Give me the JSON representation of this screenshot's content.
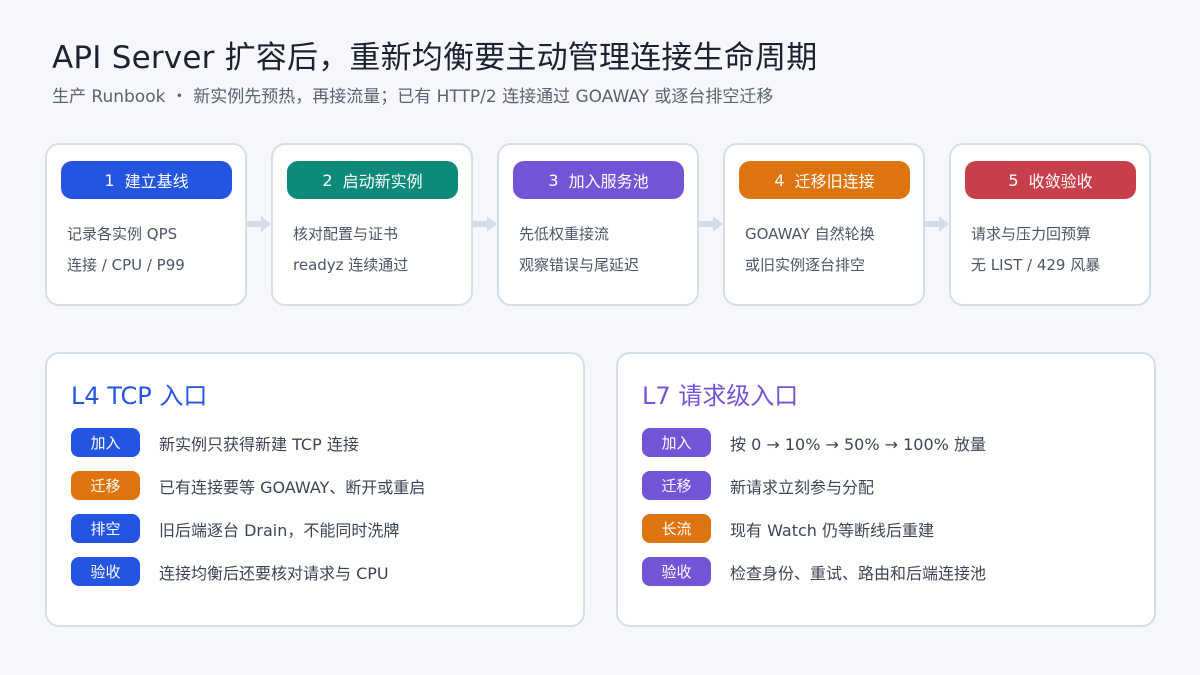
{
  "header": {
    "title": "API Server 扩容后，重新均衡要主动管理连接生命周期",
    "subtitle": "生产 Runbook ・ 新实例先预热，再接流量；已有 HTTP/2 连接通过 GOAWAY 或逐台排空迁移"
  },
  "steps": [
    {
      "num": "1",
      "label": "建立基线",
      "color": "#2355e0",
      "lines": [
        "记录各实例 QPS",
        "连接 / CPU / P99"
      ]
    },
    {
      "num": "2",
      "label": "启动新实例",
      "color": "#0e8a7a",
      "lines": [
        "核对配置与证书",
        "readyz 连续通过"
      ]
    },
    {
      "num": "3",
      "label": "加入服务池",
      "color": "#7454d6",
      "lines": [
        "先低权重接流",
        "观察错误与尾延迟"
      ]
    },
    {
      "num": "4",
      "label": "迁移旧连接",
      "color": "#de7410",
      "lines": [
        "GOAWAY 自然轮换",
        "或旧实例逐台排空"
      ]
    },
    {
      "num": "5",
      "label": "收敛验收",
      "color": "#c83f4c",
      "lines": [
        "请求与压力回预算",
        "无 LIST / 429 风暴"
      ]
    }
  ],
  "colors": {
    "arrow": "#d6dce8",
    "l4_title": "#2355e0",
    "l7_title": "#7454d6"
  },
  "panels": {
    "l4": {
      "title": "L4 TCP 入口",
      "rows": [
        {
          "tag": "加入",
          "color": "#2355e0",
          "text": "新实例只获得新建 TCP 连接"
        },
        {
          "tag": "迁移",
          "color": "#de7410",
          "text": "已有连接要等 GOAWAY、断开或重启"
        },
        {
          "tag": "排空",
          "color": "#2355e0",
          "text": "旧后端逐台 Drain，不能同时洗牌"
        },
        {
          "tag": "验收",
          "color": "#2355e0",
          "text": "连接均衡后还要核对请求与 CPU"
        }
      ]
    },
    "l7": {
      "title": "L7 请求级入口",
      "rows": [
        {
          "tag": "加入",
          "color": "#7454d6",
          "text": "按 0 → 10% → 50% → 100% 放量"
        },
        {
          "tag": "迁移",
          "color": "#7454d6",
          "text": "新请求立刻参与分配"
        },
        {
          "tag": "长流",
          "color": "#de7410",
          "text": "现有 Watch 仍等断线后重建"
        },
        {
          "tag": "验收",
          "color": "#7454d6",
          "text": "检查身份、重试、路由和后端连接池"
        }
      ]
    }
  }
}
